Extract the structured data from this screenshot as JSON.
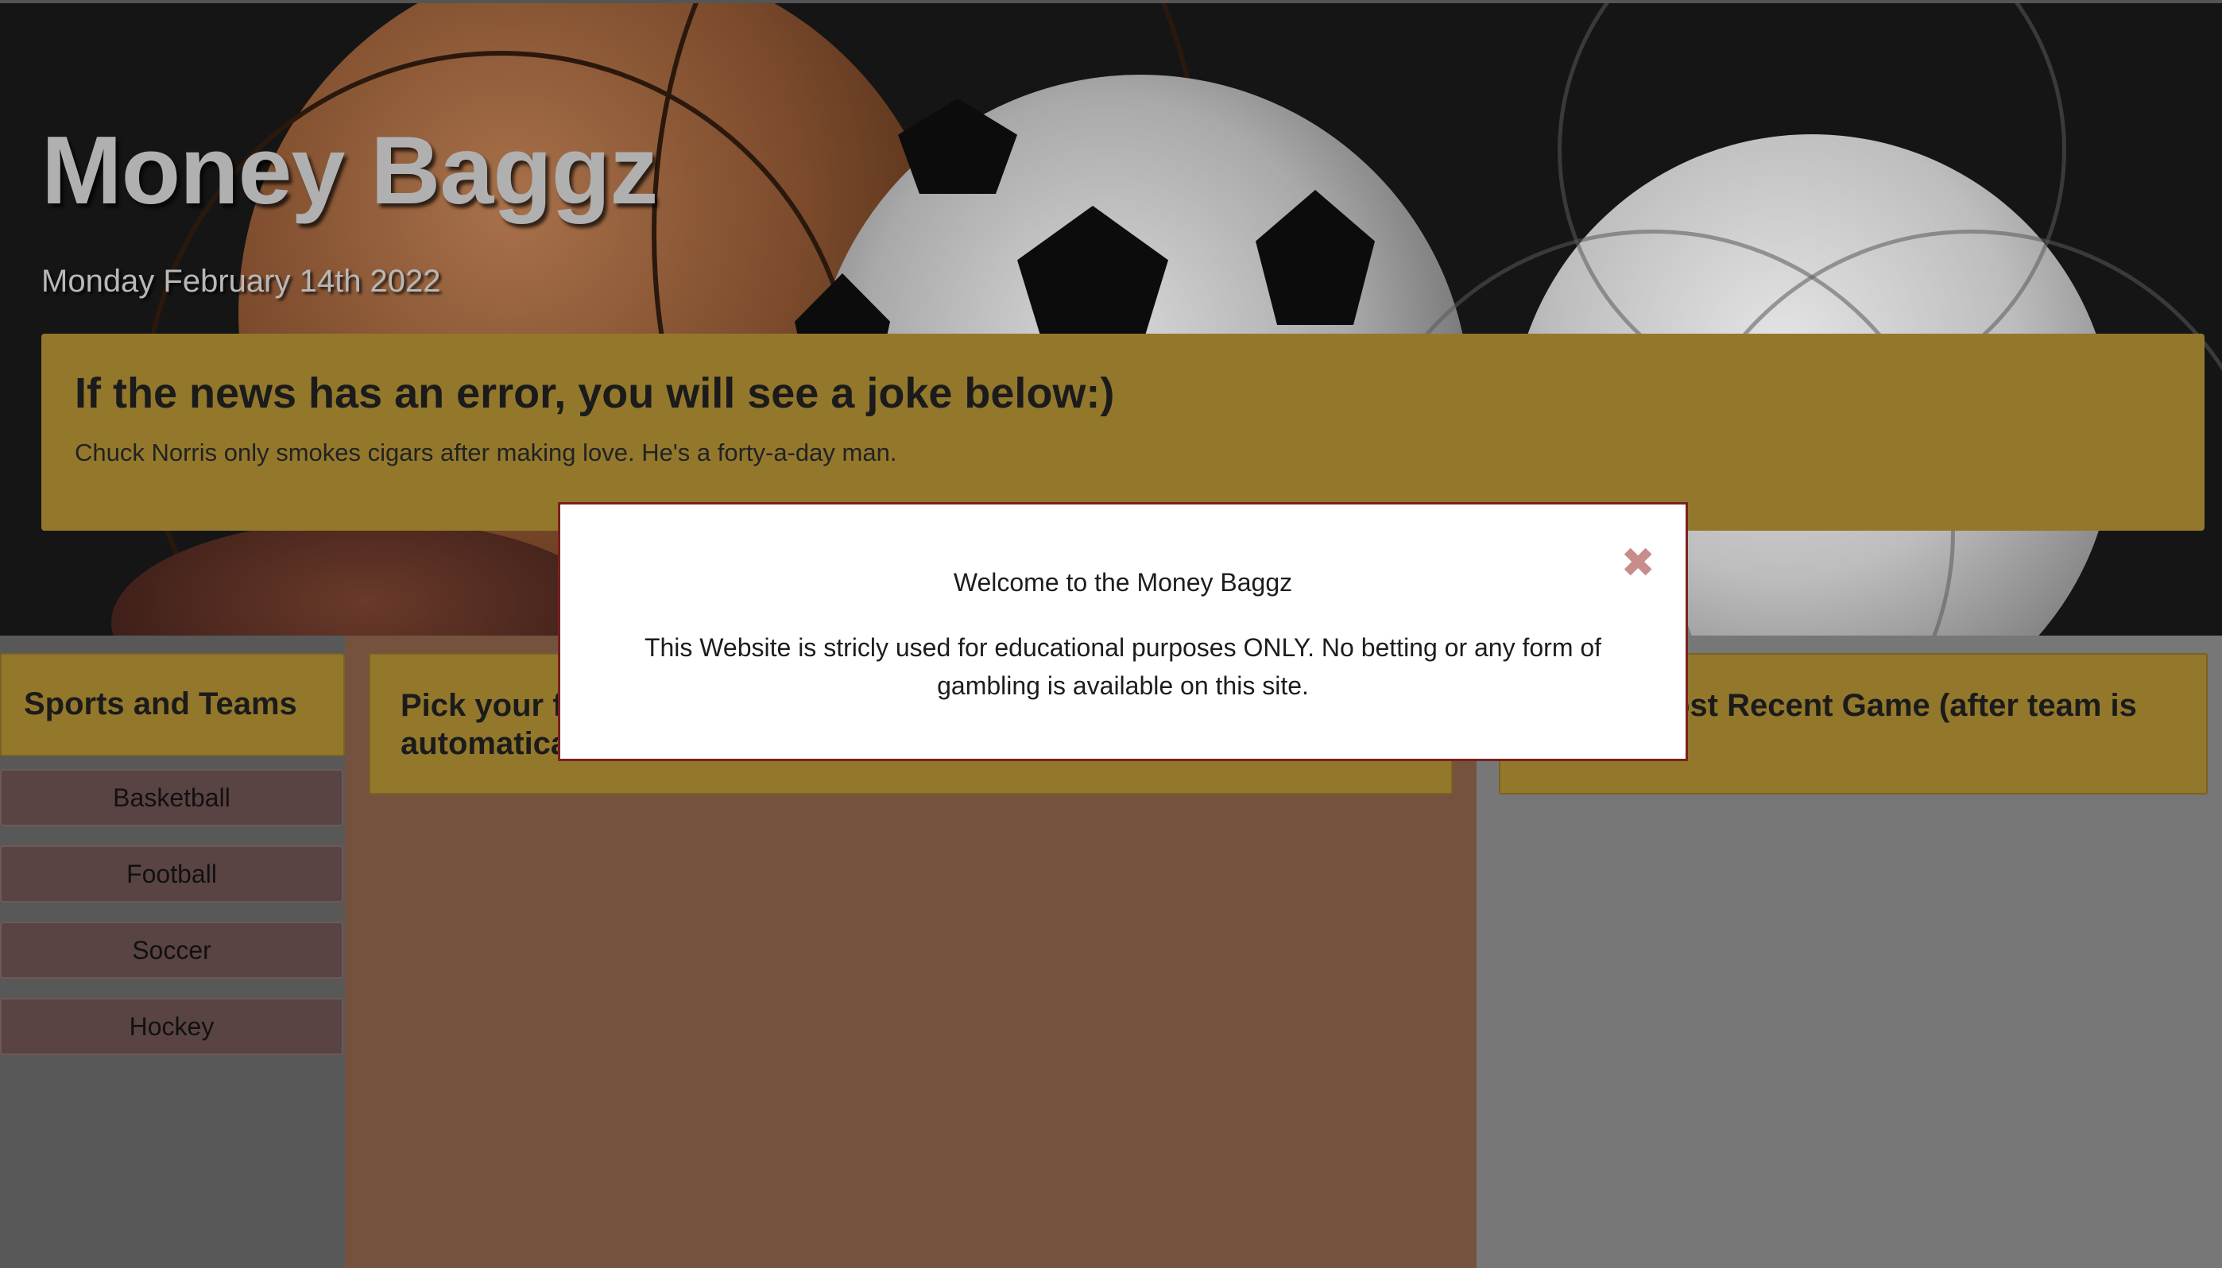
{
  "hero": {
    "title": "Money Baggz",
    "date": "Monday February 14th 2022"
  },
  "news": {
    "heading": "If the news has an error, you will see a joke below:)",
    "joke": "Chuck Norris only smokes cigars after making love. He's a forty-a-day man."
  },
  "sidebar": {
    "header": "Sports and Teams",
    "items": [
      {
        "label": "Basketball"
      },
      {
        "label": "Football"
      },
      {
        "label": "Soccer"
      },
      {
        "label": "Hockey"
      }
    ]
  },
  "middle": {
    "header_line1": "Pick your fa",
    "header_line2": "automatica"
  },
  "right": {
    "header_line1": "ost Recent Game (after team is"
  },
  "modal": {
    "title": "Welcome to the Money Baggz",
    "body": "This Website is stricly used for educational purposes ONLY. No betting or any form of gambling is available on this site.",
    "close_glyph": "✖"
  },
  "colors": {
    "accent_gold": "#93782c",
    "sport_button": "#5a4343",
    "modal_border": "#7c1f1f"
  }
}
